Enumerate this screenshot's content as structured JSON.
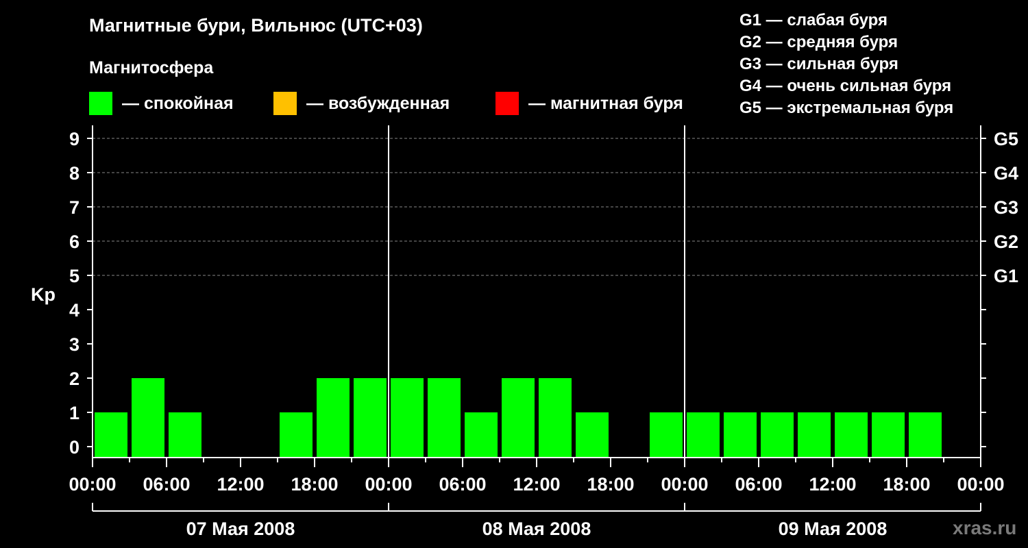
{
  "header": {
    "title": "Магнитные бури, Вильнюс (UTC+03)",
    "subtitle": "Магнитосфера"
  },
  "legend": [
    {
      "label": "— спокойная",
      "color": "#00ff00"
    },
    {
      "label": "— возбужденная",
      "color": "#ffc000"
    },
    {
      "label": "— магнитная буря",
      "color": "#ff0000"
    }
  ],
  "storm_scale": [
    "G1 — слабая буря",
    "G2 — средняя буря",
    "G3 — сильная буря",
    "G4 — очень сильная буря",
    "G5 — экстремальная буря"
  ],
  "watermark": "xras.ru",
  "chart_data": {
    "type": "bar",
    "ylabel": "Kp",
    "ylim": [
      0,
      9
    ],
    "yticks": [
      "0",
      "1",
      "2",
      "3",
      "4",
      "5",
      "6",
      "7",
      "8",
      "9"
    ],
    "right_ticks": [
      {
        "value": 5,
        "label": "G1"
      },
      {
        "value": 6,
        "label": "G2"
      },
      {
        "value": 7,
        "label": "G3"
      },
      {
        "value": 8,
        "label": "G4"
      },
      {
        "value": 9,
        "label": "G5"
      }
    ],
    "xticks": [
      "00:00",
      "06:00",
      "12:00",
      "18:00",
      "00:00",
      "06:00",
      "12:00",
      "18:00",
      "00:00",
      "06:00",
      "12:00",
      "18:00",
      "00:00"
    ],
    "days": [
      "07 Мая 2008",
      "08 Мая 2008",
      "09 Мая 2008"
    ],
    "grid": "dashed horizontal at Kp 5-9",
    "bar_interval_hours": 3,
    "values": [
      1,
      2,
      1,
      0,
      0,
      1,
      2,
      2,
      2,
      2,
      1,
      2,
      2,
      1,
      0,
      1,
      1,
      1,
      1,
      1,
      1,
      1,
      1,
      0
    ],
    "bar_color": "#00ff00"
  }
}
